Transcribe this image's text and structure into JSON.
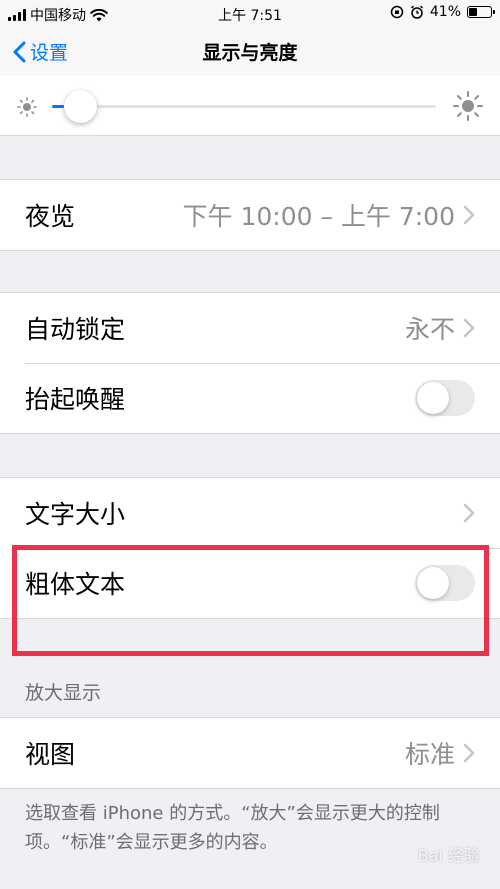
{
  "status_bar": {
    "carrier": "中国移动",
    "time": "上午 7:51",
    "battery": "41%",
    "battery_level": 0.41
  },
  "nav": {
    "back_label": "设置",
    "title": "显示与亮度"
  },
  "brightness": {
    "level": 0.03
  },
  "night_shift": {
    "label": "夜览",
    "value": "下午 10:00 – 上午 7:00"
  },
  "auto_lock": {
    "label": "自动锁定",
    "value": "永不"
  },
  "raise_to_wake": {
    "label": "抬起唤醒",
    "enabled": false
  },
  "text_size": {
    "label": "文字大小"
  },
  "bold_text": {
    "label": "粗体文本",
    "enabled": false
  },
  "display_zoom": {
    "header": "放大显示",
    "view_label": "视图",
    "view_value": "标准",
    "footer": "选取查看 iPhone 的方式。“放大”会显示更大的控制项。“标准”会显示更多的内容。"
  },
  "watermark": "Bai 经验",
  "colors": {
    "accent": "#007aff",
    "highlight": "#e8344a",
    "background": "#efeff4"
  }
}
